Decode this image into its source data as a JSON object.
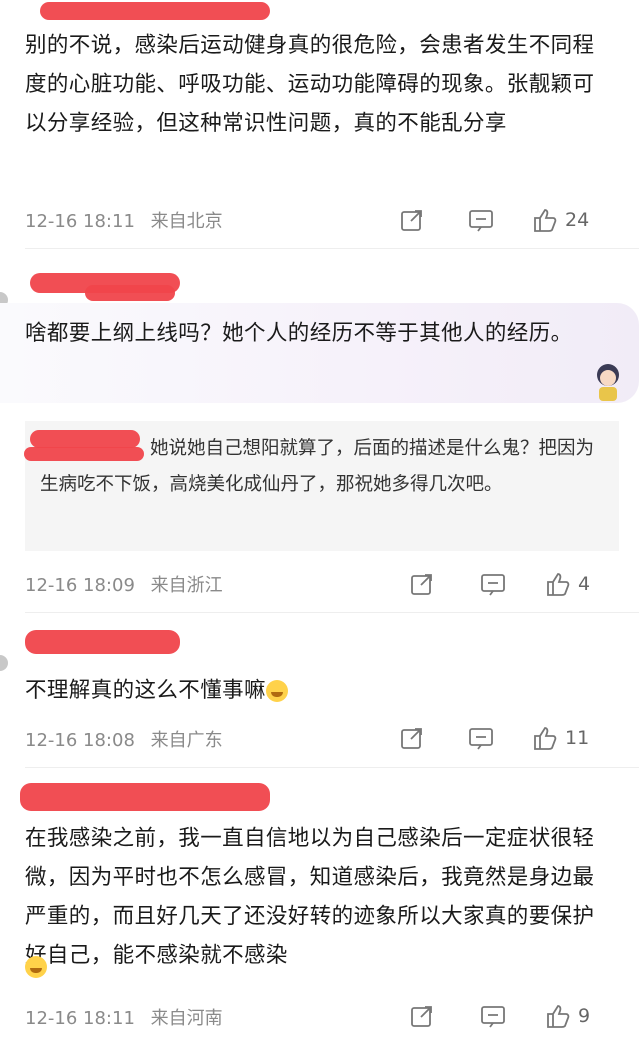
{
  "comments": [
    {
      "text": "别的不说，感染后运动健身真的很危险，会患者发生不同程度的心脏功能、呼吸功能、运动功能障碍的现象。张靓颖可以分享经验，但这种常识性问题，真的不能乱分享",
      "time": "12-16 18:11",
      "location": "来自北京",
      "likes": "24"
    },
    {
      "text": "啥都要上纲上线吗？她个人的经历不等于其他人的经历。",
      "quote": "她说她自己想阳就算了，后面的描述是什么鬼？把因为生病吃不下饭，高烧美化成仙丹了，那祝她多得几次吧。",
      "time": "12-16 18:09",
      "location": "来自浙江",
      "likes": "4"
    },
    {
      "text": "不理解真的这么不懂事嘛",
      "time": "12-16 18:08",
      "location": "来自广东",
      "likes": "11"
    },
    {
      "text": "在我感染之前，我一直自信地以为自己感染后一定症状很轻微，因为平时也不怎么感冒，知道感染后，我竟然是身边最严重的，而且好几天了还没好转的迹象所以大家真的要保护好自己，能不感染就不感染",
      "time": "12-16 18:11",
      "location": "来自河南",
      "likes": "9"
    }
  ],
  "icons": {
    "share": "share-icon",
    "comment": "comment-icon",
    "like": "like-icon"
  },
  "colors": {
    "redaction": "#f0454b",
    "meta_text": "#8a8a8a"
  }
}
